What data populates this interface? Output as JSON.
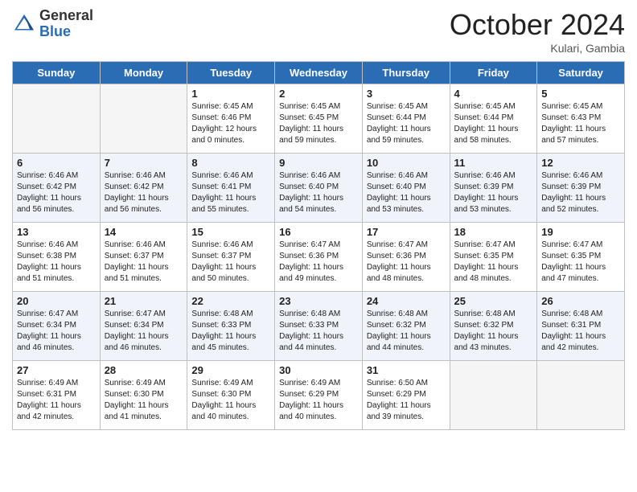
{
  "header": {
    "logo_general": "General",
    "logo_blue": "Blue",
    "month": "October 2024",
    "location": "Kulari, Gambia"
  },
  "weekdays": [
    "Sunday",
    "Monday",
    "Tuesday",
    "Wednesday",
    "Thursday",
    "Friday",
    "Saturday"
  ],
  "weeks": [
    [
      {
        "day": "",
        "info": ""
      },
      {
        "day": "",
        "info": ""
      },
      {
        "day": "1",
        "info": "Sunrise: 6:45 AM\nSunset: 6:46 PM\nDaylight: 12 hours\nand 0 minutes."
      },
      {
        "day": "2",
        "info": "Sunrise: 6:45 AM\nSunset: 6:45 PM\nDaylight: 11 hours\nand 59 minutes."
      },
      {
        "day": "3",
        "info": "Sunrise: 6:45 AM\nSunset: 6:44 PM\nDaylight: 11 hours\nand 59 minutes."
      },
      {
        "day": "4",
        "info": "Sunrise: 6:45 AM\nSunset: 6:44 PM\nDaylight: 11 hours\nand 58 minutes."
      },
      {
        "day": "5",
        "info": "Sunrise: 6:45 AM\nSunset: 6:43 PM\nDaylight: 11 hours\nand 57 minutes."
      }
    ],
    [
      {
        "day": "6",
        "info": "Sunrise: 6:46 AM\nSunset: 6:42 PM\nDaylight: 11 hours\nand 56 minutes."
      },
      {
        "day": "7",
        "info": "Sunrise: 6:46 AM\nSunset: 6:42 PM\nDaylight: 11 hours\nand 56 minutes."
      },
      {
        "day": "8",
        "info": "Sunrise: 6:46 AM\nSunset: 6:41 PM\nDaylight: 11 hours\nand 55 minutes."
      },
      {
        "day": "9",
        "info": "Sunrise: 6:46 AM\nSunset: 6:40 PM\nDaylight: 11 hours\nand 54 minutes."
      },
      {
        "day": "10",
        "info": "Sunrise: 6:46 AM\nSunset: 6:40 PM\nDaylight: 11 hours\nand 53 minutes."
      },
      {
        "day": "11",
        "info": "Sunrise: 6:46 AM\nSunset: 6:39 PM\nDaylight: 11 hours\nand 53 minutes."
      },
      {
        "day": "12",
        "info": "Sunrise: 6:46 AM\nSunset: 6:39 PM\nDaylight: 11 hours\nand 52 minutes."
      }
    ],
    [
      {
        "day": "13",
        "info": "Sunrise: 6:46 AM\nSunset: 6:38 PM\nDaylight: 11 hours\nand 51 minutes."
      },
      {
        "day": "14",
        "info": "Sunrise: 6:46 AM\nSunset: 6:37 PM\nDaylight: 11 hours\nand 51 minutes."
      },
      {
        "day": "15",
        "info": "Sunrise: 6:46 AM\nSunset: 6:37 PM\nDaylight: 11 hours\nand 50 minutes."
      },
      {
        "day": "16",
        "info": "Sunrise: 6:47 AM\nSunset: 6:36 PM\nDaylight: 11 hours\nand 49 minutes."
      },
      {
        "day": "17",
        "info": "Sunrise: 6:47 AM\nSunset: 6:36 PM\nDaylight: 11 hours\nand 48 minutes."
      },
      {
        "day": "18",
        "info": "Sunrise: 6:47 AM\nSunset: 6:35 PM\nDaylight: 11 hours\nand 48 minutes."
      },
      {
        "day": "19",
        "info": "Sunrise: 6:47 AM\nSunset: 6:35 PM\nDaylight: 11 hours\nand 47 minutes."
      }
    ],
    [
      {
        "day": "20",
        "info": "Sunrise: 6:47 AM\nSunset: 6:34 PM\nDaylight: 11 hours\nand 46 minutes."
      },
      {
        "day": "21",
        "info": "Sunrise: 6:47 AM\nSunset: 6:34 PM\nDaylight: 11 hours\nand 46 minutes."
      },
      {
        "day": "22",
        "info": "Sunrise: 6:48 AM\nSunset: 6:33 PM\nDaylight: 11 hours\nand 45 minutes."
      },
      {
        "day": "23",
        "info": "Sunrise: 6:48 AM\nSunset: 6:33 PM\nDaylight: 11 hours\nand 44 minutes."
      },
      {
        "day": "24",
        "info": "Sunrise: 6:48 AM\nSunset: 6:32 PM\nDaylight: 11 hours\nand 44 minutes."
      },
      {
        "day": "25",
        "info": "Sunrise: 6:48 AM\nSunset: 6:32 PM\nDaylight: 11 hours\nand 43 minutes."
      },
      {
        "day": "26",
        "info": "Sunrise: 6:48 AM\nSunset: 6:31 PM\nDaylight: 11 hours\nand 42 minutes."
      }
    ],
    [
      {
        "day": "27",
        "info": "Sunrise: 6:49 AM\nSunset: 6:31 PM\nDaylight: 11 hours\nand 42 minutes."
      },
      {
        "day": "28",
        "info": "Sunrise: 6:49 AM\nSunset: 6:30 PM\nDaylight: 11 hours\nand 41 minutes."
      },
      {
        "day": "29",
        "info": "Sunrise: 6:49 AM\nSunset: 6:30 PM\nDaylight: 11 hours\nand 40 minutes."
      },
      {
        "day": "30",
        "info": "Sunrise: 6:49 AM\nSunset: 6:29 PM\nDaylight: 11 hours\nand 40 minutes."
      },
      {
        "day": "31",
        "info": "Sunrise: 6:50 AM\nSunset: 6:29 PM\nDaylight: 11 hours\nand 39 minutes."
      },
      {
        "day": "",
        "info": ""
      },
      {
        "day": "",
        "info": ""
      }
    ]
  ]
}
